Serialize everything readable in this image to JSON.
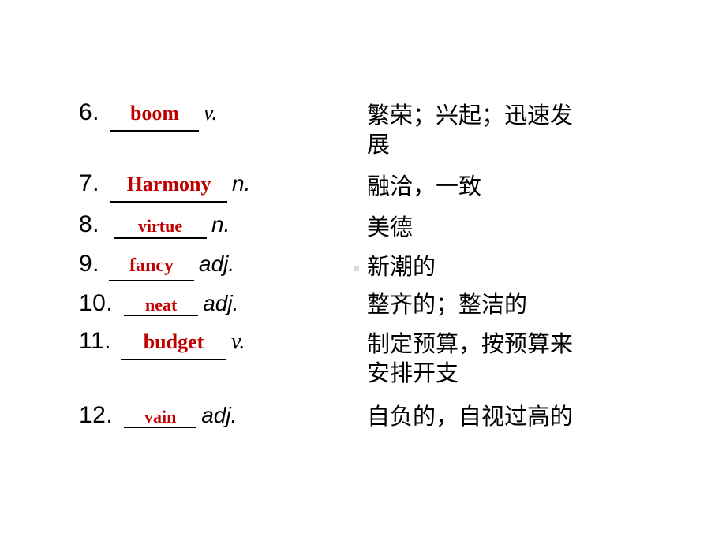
{
  "slide": {
    "background_color": "#FFFFFF",
    "answer_color": "#C00000",
    "text_color": "#000000",
    "bullet_marker_color": "#D9D9D9"
  },
  "vocab": {
    "items": [
      {
        "number": "6.",
        "answer": "boom",
        "pos": "v.",
        "meaning": "繁荣；兴起；迅速发\n展"
      },
      {
        "number": "7.",
        "answer": "Harmony",
        "pos": "n.",
        "meaning": "融洽，一致"
      },
      {
        "number": "8.",
        "answer": "virtue",
        "pos": "n.",
        "meaning": "美德"
      },
      {
        "number": "9.",
        "answer": "fancy",
        "pos": "adj.",
        "meaning": "新潮的"
      },
      {
        "number": "10.",
        "answer": "neat",
        "pos": "adj.",
        "meaning": "整齐的；整洁的"
      },
      {
        "number": "11.",
        "answer": "budget",
        "pos": "v.",
        "meaning": "制定预算，按预算来\n安排开支"
      },
      {
        "number": "12.",
        "answer": "vain",
        "pos": "adj.",
        "meaning": "自负的，自视过高的"
      }
    ]
  }
}
